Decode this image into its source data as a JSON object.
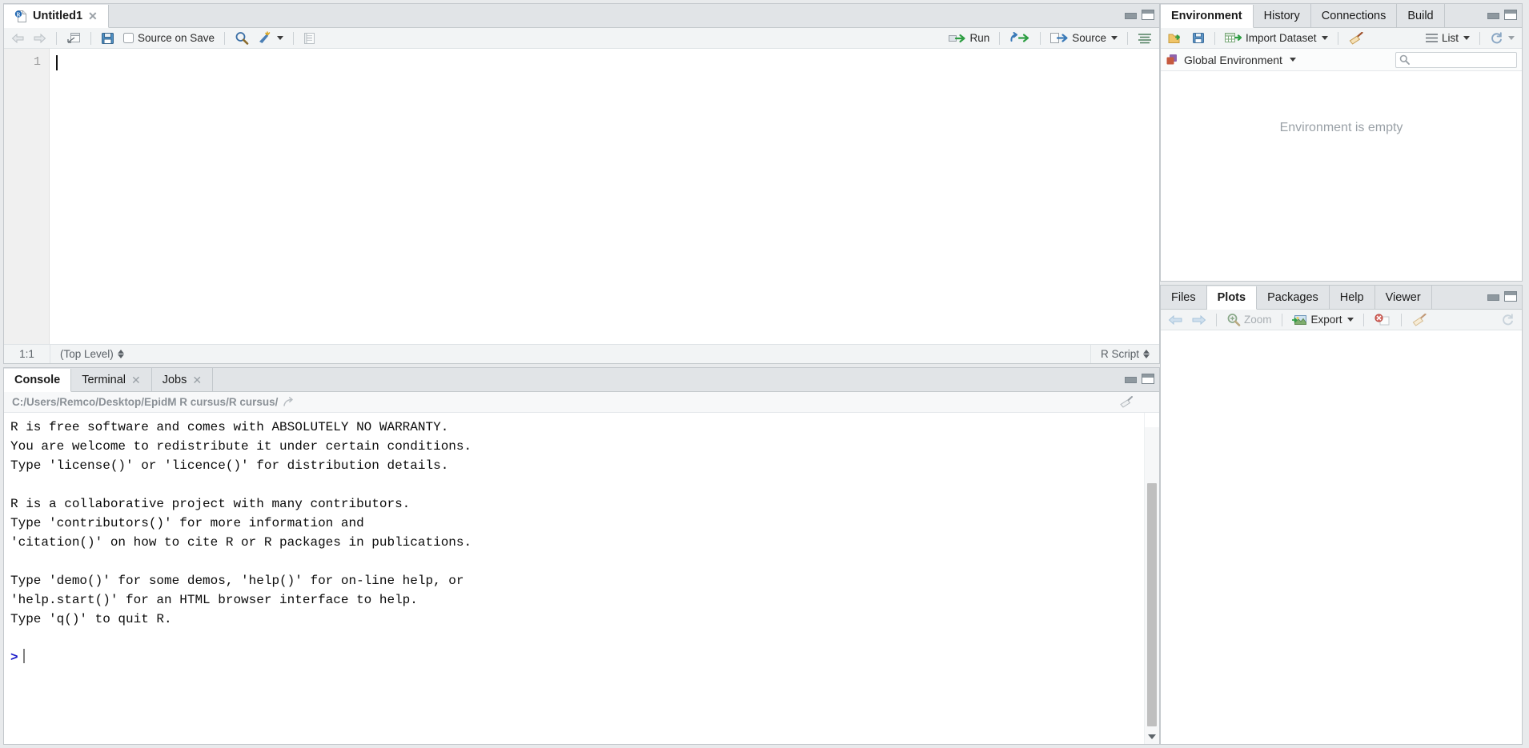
{
  "source_pane": {
    "tabs": [
      {
        "label": "Untitled1",
        "icon": "r-script-icon",
        "closable": true,
        "active": true
      }
    ],
    "toolbar": {
      "back_label": "Back",
      "forward_label": "Forward",
      "popout_label": "Show in new window",
      "save_label": "Save current document",
      "source_on_save_label": "Source on Save",
      "source_on_save_checked": false,
      "find_label": "Find/Replace",
      "magic_label": "Code Tools",
      "compile_label": "Compile Report",
      "run_label": "Run",
      "rerun_label": "Re-run previous code region",
      "source_label": "Source",
      "outline_label": "Show document outline"
    },
    "status": {
      "cursor_position": "1:1",
      "scope": "(Top Level)",
      "doc_type": "R Script"
    },
    "editor": {
      "line_numbers": [
        "1"
      ],
      "lines": [
        ""
      ]
    }
  },
  "console_pane": {
    "tabs": [
      {
        "label": "Console",
        "closable": false,
        "active": true
      },
      {
        "label": "Terminal",
        "closable": true,
        "active": false
      },
      {
        "label": "Jobs",
        "closable": true,
        "active": false
      }
    ],
    "working_directory": "C:/Users/Remco/Desktop/EpidM R cursus/R cursus/",
    "clear_label": "Clear console",
    "output_lines": [
      "R is free software and comes with ABSOLUTELY NO WARRANTY.",
      "You are welcome to redistribute it under certain conditions.",
      "Type 'license()' or 'licence()' for distribution details.",
      "",
      "R is a collaborative project with many contributors.",
      "Type 'contributors()' for more information and",
      "'citation()' on how to cite R or R packages in publications.",
      "",
      "Type 'demo()' for some demos, 'help()' for on-line help, or",
      "'help.start()' for an HTML browser interface to help.",
      "Type 'q()' to quit R.",
      ""
    ],
    "prompt_symbol": ">",
    "prompt_input": ""
  },
  "environment_pane": {
    "tabs": [
      {
        "label": "Environment",
        "active": true
      },
      {
        "label": "History",
        "active": false
      },
      {
        "label": "Connections",
        "active": false
      },
      {
        "label": "Build",
        "active": false
      }
    ],
    "toolbar": {
      "load_label": "Load workspace",
      "save_label": "Save workspace",
      "import_dataset_label": "Import Dataset",
      "clear_label": "Clear objects from the workspace",
      "view_mode_label": "List",
      "refresh_label": "Refresh"
    },
    "scope_selector": "Global Environment",
    "search_placeholder": "",
    "empty_message": "Environment is empty"
  },
  "plots_pane": {
    "tabs": [
      {
        "label": "Files",
        "active": false
      },
      {
        "label": "Plots",
        "active": true
      },
      {
        "label": "Packages",
        "active": false
      },
      {
        "label": "Help",
        "active": false
      },
      {
        "label": "Viewer",
        "active": false
      }
    ],
    "toolbar": {
      "back_label": "Previous plot",
      "forward_label": "Next plot",
      "zoom_label": "Zoom",
      "export_label": "Export",
      "remove_label": "Remove current plot",
      "clear_all_label": "Clear all plots",
      "refresh_label": "Refresh"
    }
  },
  "colors": {
    "accent_blue": "#1c7bd4",
    "run_green": "#2e9e43",
    "prompt_blue": "#1414c8",
    "chrome_grey": "#e1e4e7",
    "pane_border": "#c3c8cc",
    "muted_text": "#9aa1a7"
  }
}
